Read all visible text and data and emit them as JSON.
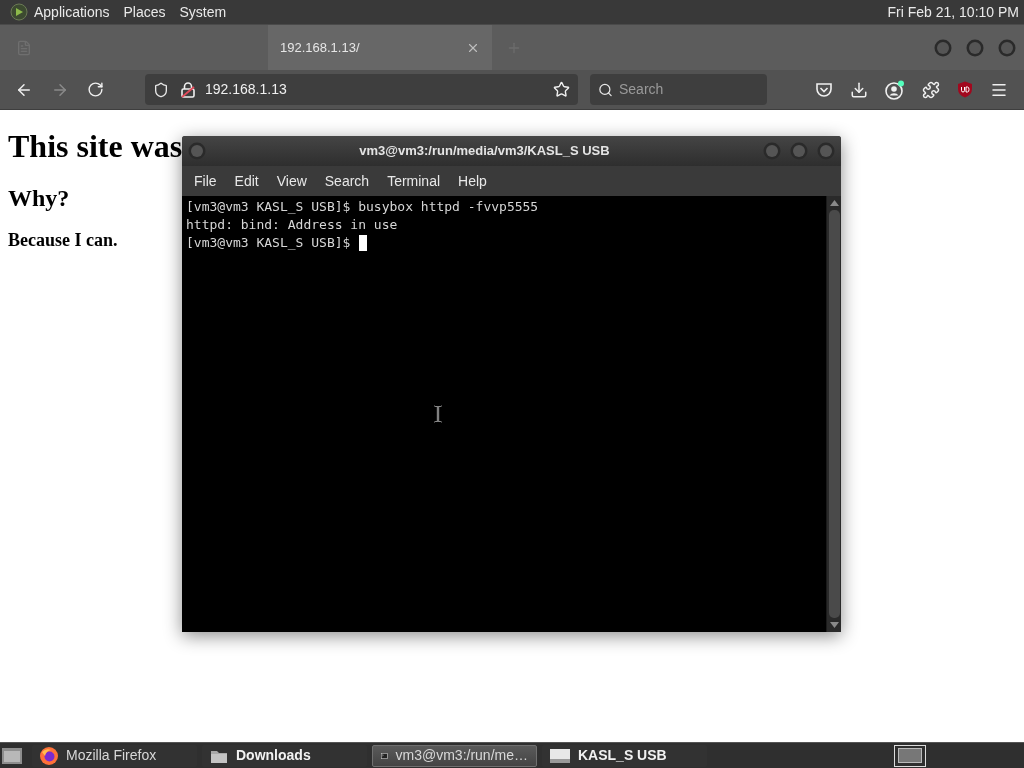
{
  "top_panel": {
    "menus": [
      "Applications",
      "Places",
      "System"
    ],
    "clock": "Fri Feb 21, 10:10 PM"
  },
  "browser": {
    "tabs": [
      {
        "selected": false
      },
      {
        "label": "192.168.1.13/",
        "selected": true
      }
    ],
    "back": {
      "disabled": false
    },
    "forward": {
      "disabled": true
    },
    "address": "192.168.1.13",
    "search": {
      "placeholder": "Search"
    }
  },
  "page": {
    "heading": "This site was",
    "subheading": "Why?",
    "text": "Because I can."
  },
  "terminal": {
    "title": "vm3@vm3:/run/media/vm3/KASL_S USB",
    "menus": [
      "File",
      "Edit",
      "View",
      "Search",
      "Terminal",
      "Help"
    ],
    "lines": [
      {
        "text": "[vm3@vm3 KASL_S USB]$ busybox httpd -fvvp5555",
        "cursor": false
      },
      {
        "text": "httpd: bind: Address in use",
        "cursor": false
      },
      {
        "text": "[vm3@vm3 KASL_S USB]$",
        "cursor": true
      }
    ]
  },
  "taskbar": {
    "windows": [
      {
        "kind": "browser",
        "label": "Mozilla Firefox",
        "selected": false,
        "attention": false
      },
      {
        "kind": "folder",
        "label": "Downloads",
        "selected": false,
        "attention": true
      },
      {
        "kind": "terminal",
        "label": "vm3@vm3:/run/me…",
        "selected": true,
        "attention": false
      },
      {
        "kind": "drive",
        "label": "KASL_S USB",
        "selected": false,
        "attention": true
      }
    ]
  }
}
